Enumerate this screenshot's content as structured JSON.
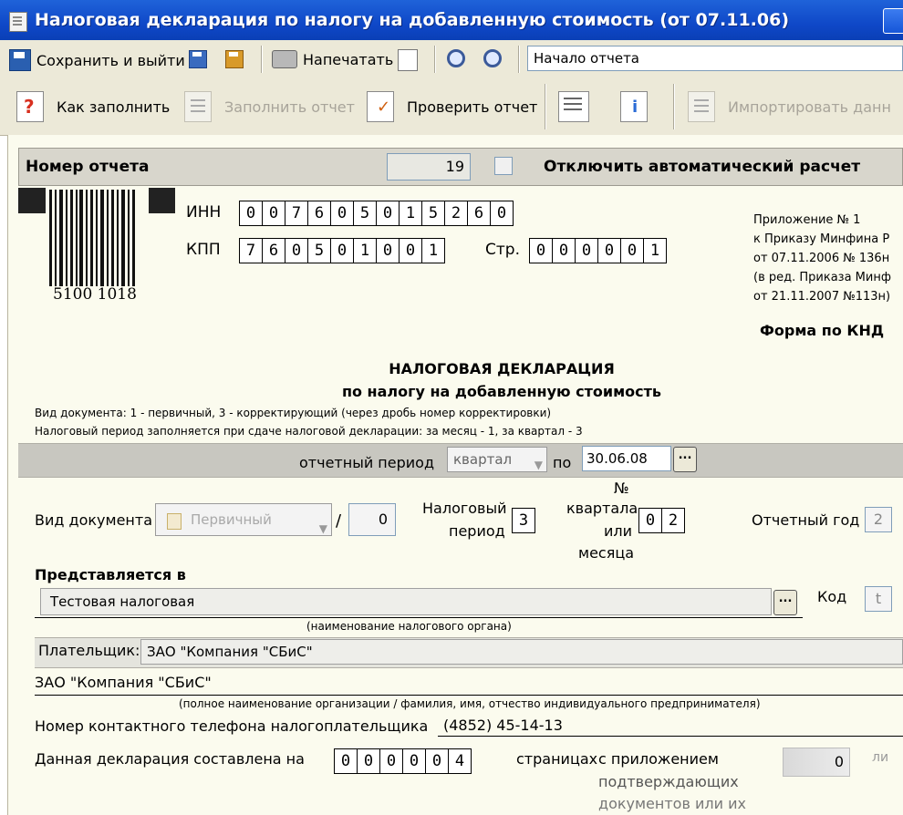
{
  "window": {
    "title": "Налоговая декларация по налогу на добавленную стоимость (от 07.11.06)"
  },
  "toolbar1": {
    "save_exit": "Сохранить и выйти",
    "print": "Напечатать",
    "section_combo": "Начало отчета"
  },
  "toolbar2": {
    "how_to_fill": "Как заполнить",
    "fill_report": "Заполнить отчет",
    "check_report": "Проверить отчет",
    "import_data": "Импортировать данн"
  },
  "header_bar": {
    "report_number_label": "Номер отчета",
    "report_number": "19",
    "auto_calc_label": "Отключить автоматический расчет"
  },
  "barcode_number": "5100 1018",
  "ids": {
    "inn_label": "ИНН",
    "inn": [
      "0",
      "0",
      "7",
      "6",
      "0",
      "5",
      "0",
      "1",
      "5",
      "2",
      "6",
      "0"
    ],
    "kpp_label": "КПП",
    "kpp": [
      "7",
      "6",
      "0",
      "5",
      "0",
      "1",
      "0",
      "0",
      "1"
    ],
    "page_label": "Стр.",
    "page": [
      "0",
      "0",
      "0",
      "0",
      "0",
      "1"
    ]
  },
  "appendix": {
    "line1": "Приложение № 1",
    "line2": "к Приказу Минфина Р",
    "line3": "от 07.11.2006 № 136н",
    "line4": "(в ред. Приказа Минф",
    "line5": "от 21.11.2007 №113н)",
    "knd": "Форма по КНД"
  },
  "title": {
    "line1": "НАЛОГОВАЯ ДЕКЛАРАЦИЯ",
    "line2": "по налогу на добавленную стоимость"
  },
  "notes": {
    "doc_type": "Вид документа: 1 - первичный, 3 - корректирующий (через дробь номер корректировки)",
    "period": "Налоговый период заполняется при сдаче налоговой декларации: за месяц - 1, за квартал - 3"
  },
  "period_bar": {
    "label": "отчетный период",
    "period_value": "квартал",
    "to_label": "по",
    "to_date": "30.06.08"
  },
  "doc": {
    "type_label": "Вид документа",
    "type_value": "Первичный",
    "slash": "/",
    "correction": "0",
    "tax_period_label1": "Налоговый",
    "tax_period_label2": "период",
    "tax_period": "3",
    "quarter_label1": "№",
    "quarter_label2": "квартала",
    "quarter_label3": "или",
    "quarter_label4": "месяца",
    "quarter": [
      "0",
      "2"
    ],
    "year_label": "Отчетный год",
    "year_value": "2"
  },
  "authority": {
    "label": "Представляется в",
    "value": "Тестовая налоговая",
    "caption": "(наименование налогового органа)",
    "code_label": "Код",
    "code_value": "t"
  },
  "payer": {
    "label": "Плательщик:",
    "value": "ЗАО \"Компания \"СБиС\"",
    "full_name": "ЗАО \"Компания \"СБиС\"",
    "caption": "(полное наименование организации / фамилия, имя, отчество индивидуального предпринимателя)"
  },
  "phone": {
    "label": "Номер контактного телефона налогоплательщика",
    "value": "(4852) 45-14-13"
  },
  "pages": {
    "label": "Данная декларация составлена на",
    "digits": [
      "0",
      "0",
      "0",
      "0",
      "0",
      "4"
    ],
    "after": "страницах",
    "with_app": "с приложением",
    "confirm": "подтверждающих",
    "docs": "документов или их",
    "count": "0",
    "suffix": "ли"
  },
  "colors": {
    "title_bar": "#0f48c8",
    "toolbar": "#ece9d8",
    "form_bg": "#fbfbee"
  }
}
